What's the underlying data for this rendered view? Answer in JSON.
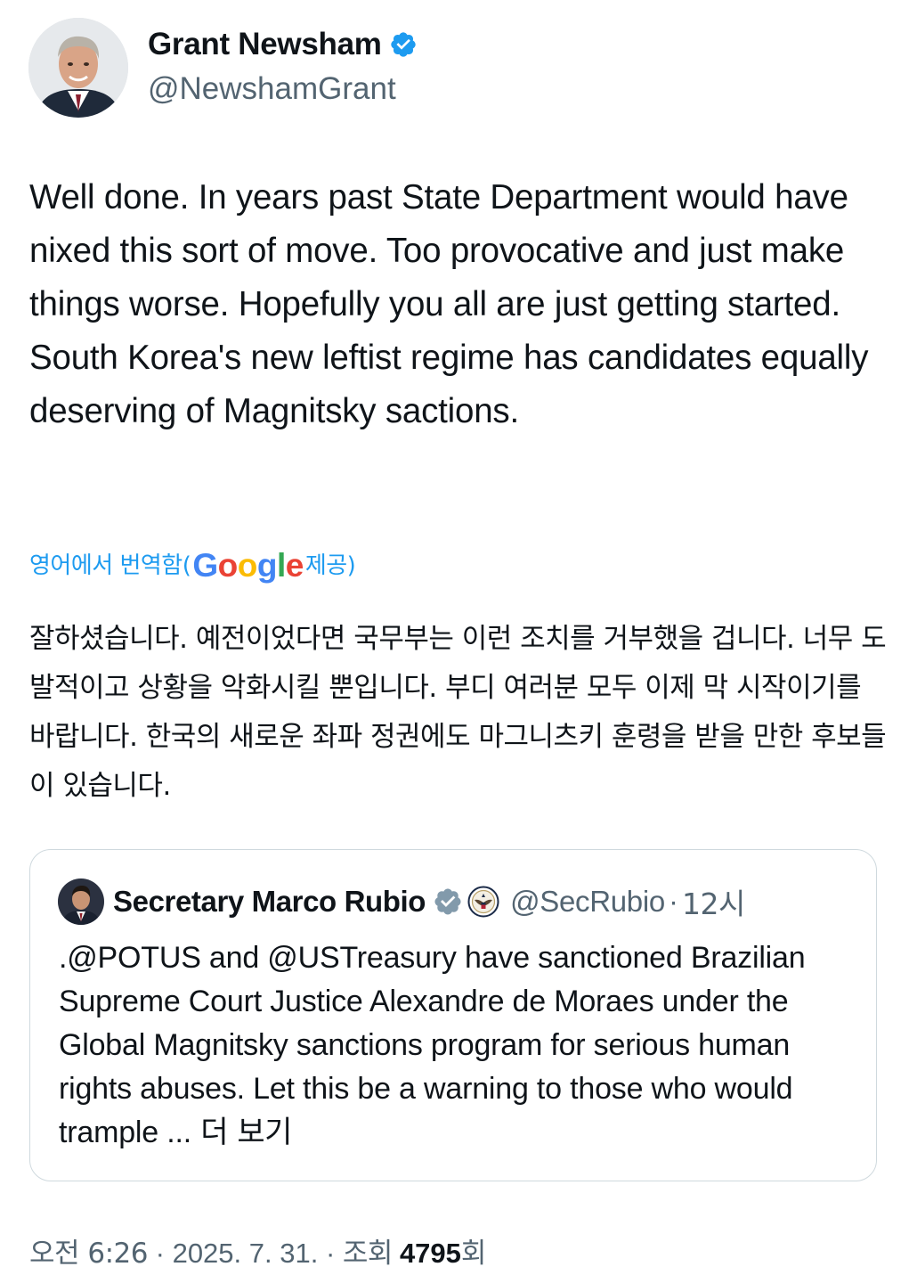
{
  "author": {
    "display_name": "Grant Newsham",
    "handle": "@NewshamGrant",
    "avatar_icon": "person-avatar-icon",
    "verified_icon": "verified-badge-icon",
    "verified_color": "#1d9bf0"
  },
  "tweet": {
    "text": "Well done. In years past State Department would have nixed this sort of move. Too provocative and just make things worse.  Hopefully you all are just getting started.  South Korea's new leftist regime has candidates equally deserving of Magnitsky sactions."
  },
  "translation": {
    "prefix": "영어에서 번역함(",
    "google_letters": [
      "G",
      "o",
      "o",
      "g",
      "l",
      "e"
    ],
    "suffix": " 제공)",
    "text": "잘하셨습니다. 예전이었다면 국무부는 이런 조치를 거부했을 겁니다. 너무 도발적이고 상황을 악화시킬 뿐입니다. 부디 여러분 모두 이제 막 시작이기를 바랍니다. 한국의 새로운 좌파 정권에도 마그니츠키 훈령을 받을 만한 후보들이 있습니다.",
    "link_color": "#1d9bf0"
  },
  "quoted_tweet": {
    "display_name": "Secretary Marco Rubio",
    "handle": "@SecRubio",
    "separator": "·",
    "time": "12시",
    "verified_icon": "gray-verified-badge-icon",
    "affiliation_icon": "state-department-seal-icon",
    "text": ".@POTUS and @USTreasury have sanctioned Brazilian Supreme Court Justice Alexandre de Moraes under the Global Magnitsky sanctions program for serious human rights abuses. Let this be a warning to those who would trample ...",
    "more_label": " 더 보기"
  },
  "meta": {
    "time": "오전 6:26",
    "sep1": " · ",
    "date": "2025. 7. 31.",
    "sep2": " · ",
    "views_label": "조회",
    "views_count": "4795",
    "views_suffix": "회"
  }
}
